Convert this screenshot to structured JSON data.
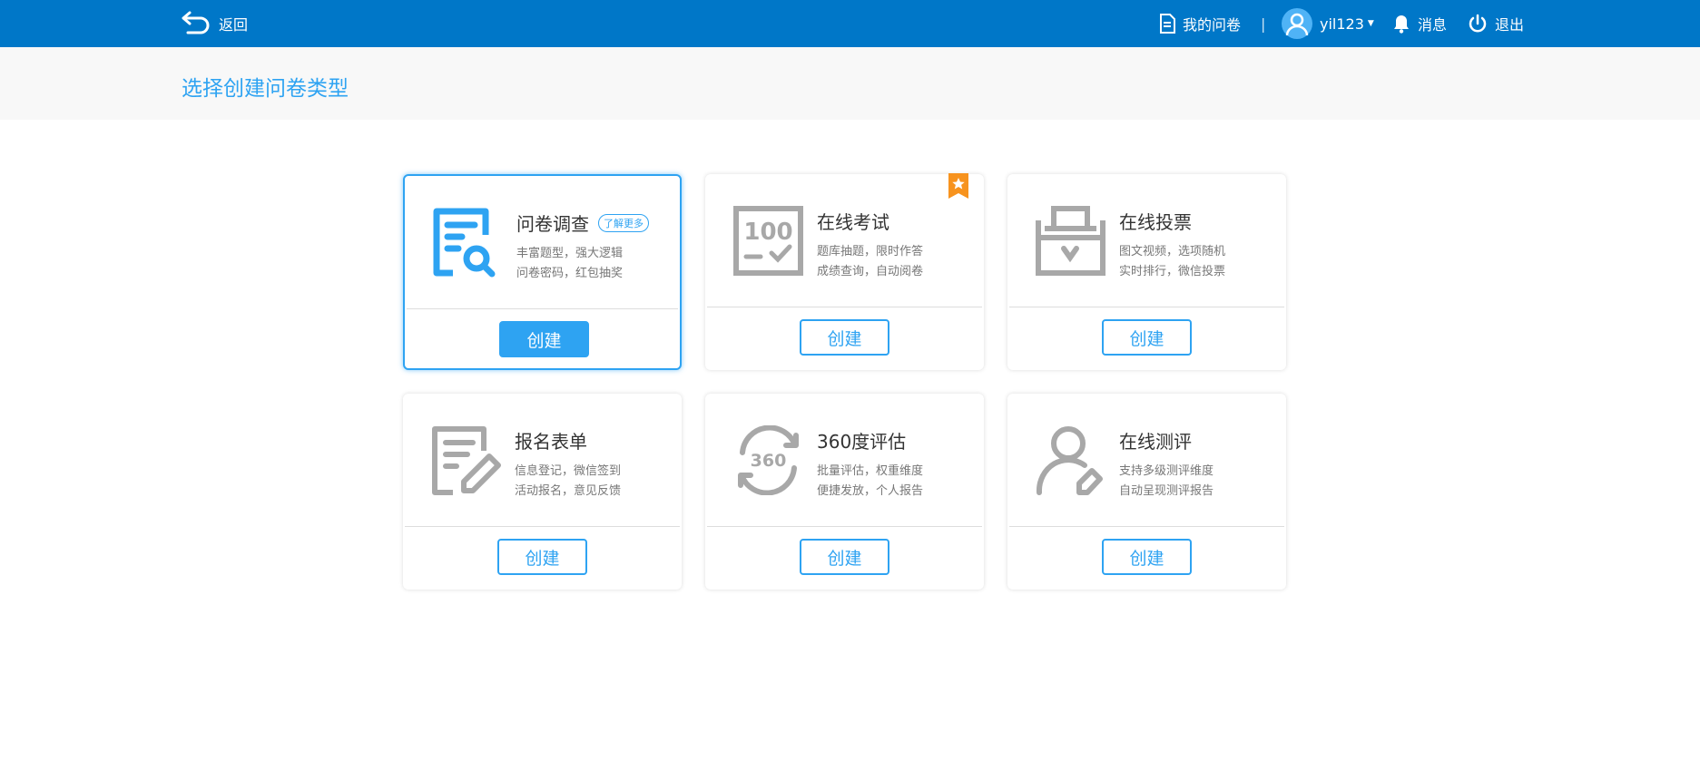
{
  "header": {
    "back_label": "返回",
    "my_surveys": "我的问卷",
    "separator": "|",
    "username": "yil123",
    "messages": "消息",
    "logout": "退出"
  },
  "page_title": "选择创建问卷类型",
  "accent": "#2ea3f2",
  "cards": [
    {
      "title": "问卷调查",
      "tag": "了解更多",
      "line1": "丰富题型，强大逻辑",
      "line2": "问卷密码，红包抽奖",
      "button": "创建",
      "icon": "survey-search-icon"
    },
    {
      "title": "在线考试",
      "line1": "题库抽题，限时作答",
      "line2": "成绩查询，自动阅卷",
      "button": "创建",
      "icon": "exam-100-icon"
    },
    {
      "title": "在线投票",
      "line1": "图文视频，选项随机",
      "line2": "实时排行，微信投票",
      "button": "创建",
      "icon": "ballot-box-icon"
    },
    {
      "title": "报名表单",
      "line1": "信息登记，微信签到",
      "line2": "活动报名，意见反馈",
      "button": "创建",
      "icon": "form-edit-icon"
    },
    {
      "title": "360度评估",
      "line1": "批量评估，权重维度",
      "line2": "便捷发放，个人报告",
      "button": "创建",
      "icon": "360-cycle-icon"
    },
    {
      "title": "在线测评",
      "line1": "支持多级测评维度",
      "line2": "自动呈现测评报告",
      "button": "创建",
      "icon": "user-edit-icon"
    }
  ]
}
